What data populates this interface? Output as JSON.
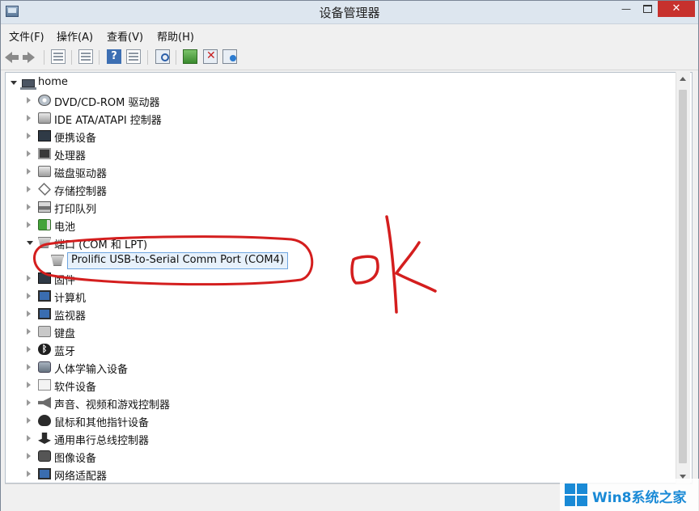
{
  "window": {
    "title": "设备管理器",
    "close_label": "✕",
    "minimize_label": "—"
  },
  "menu": [
    "文件(F)",
    "操作(A)",
    "查看(V)",
    "帮助(H)"
  ],
  "tree": {
    "root": "home",
    "items": [
      "DVD/CD-ROM 驱动器",
      "IDE ATA/ATAPI 控制器",
      "便携设备",
      "处理器",
      "磁盘驱动器",
      "存储控制器",
      "打印队列",
      "电池",
      "端口 (COM 和 LPT)",
      "Prolific USB-to-Serial Comm Port (COM4)",
      "固件",
      "计算机",
      "监视器",
      "键盘",
      "蓝牙",
      "人体学输入设备",
      "软件设备",
      "声音、视频和游戏控制器",
      "鼠标和其他指针设备",
      "通用串行总线控制器",
      "图像设备",
      "网络适配器"
    ]
  },
  "annotation": {
    "ink_color": "#d41e1e"
  },
  "watermark": {
    "text": "Win8系统之家"
  },
  "colors": {
    "accent": "#1a8ad6",
    "close_button": "#c7312d",
    "selection": "#6ea5e0"
  }
}
